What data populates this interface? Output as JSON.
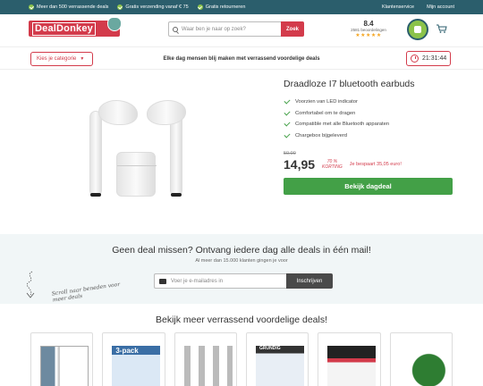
{
  "topbar": {
    "usps": [
      "Meer dan 500 verrassende deals",
      "Gratis verzending vanaf € 75",
      "Gratis retourneren"
    ],
    "links": [
      "Klantenservice",
      "Mijn account"
    ]
  },
  "header": {
    "logo_text": "DealDonkey",
    "search_placeholder": "Waar ben je naar op zoek?",
    "search_button": "Zoek",
    "rating_score": "8.4",
    "rating_count": "2581 beoordelingen",
    "rating_stars": "★★★★★"
  },
  "subnav": {
    "category_button": "Kies je categorie",
    "tagline": "Elke dag mensen blij maken met verrassend voordelige deals",
    "timer": "21:31:44"
  },
  "product": {
    "title": "Draadloze I7 bluetooth earbuds",
    "features": [
      "Voorzien van LED indicator",
      "Comfortabel om te dragen",
      "Compatible met alle Bluetooth apparaten",
      "Chargebox bijgeleverd"
    ],
    "old_price": "50,00",
    "price": "14,95",
    "discount_pct": "70 %",
    "discount_label": "KORTING",
    "savings": "Je bespaart 35,05 euro!",
    "buy_button": "Bekijk dagdeal"
  },
  "newsletter": {
    "title": "Geen deal missen? Ontvang iedere dag alle deals in één mail!",
    "subtitle": "Al meer dan 15.000 klanten gingen je voor",
    "scroll_hint": "Scroll naar beneden voor meer deals",
    "input_placeholder": "Voer je e-mailadres in",
    "submit_button": "Inschrijven"
  },
  "more": {
    "title": "Bekijk meer verrassend voordelige deals!"
  },
  "colors": {
    "brand_red": "#d33b4b",
    "topbar_teal": "#2b5e6c",
    "buy_green": "#43a047"
  }
}
